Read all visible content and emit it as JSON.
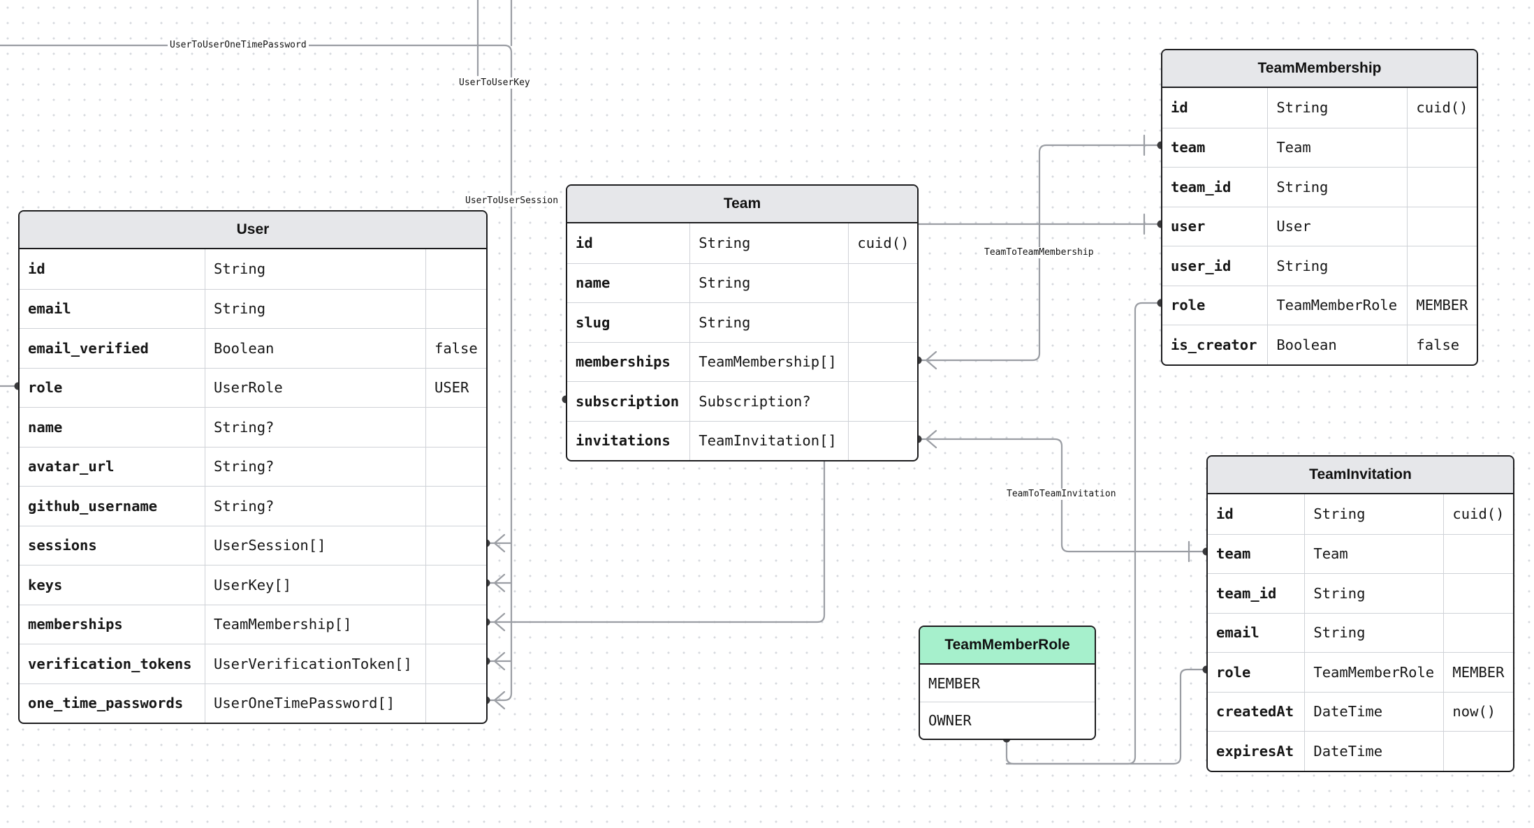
{
  "relations": {
    "user_to_user_one_time_password": "UserToUserOneTimePassword",
    "user_to_user_key": "UserToUserKey",
    "user_to_user_session": "UserToUserSession",
    "team_to_team_membership": "TeamToTeamMembership",
    "team_to_team_invitation": "TeamToTeamInvitation"
  },
  "models": {
    "user": {
      "name": "User",
      "fields": [
        {
          "name": "id",
          "type": "String",
          "default": ""
        },
        {
          "name": "email",
          "type": "String",
          "default": ""
        },
        {
          "name": "email_verified",
          "type": "Boolean",
          "default": "false"
        },
        {
          "name": "role",
          "type": "UserRole",
          "default": "USER"
        },
        {
          "name": "name",
          "type": "String?",
          "default": ""
        },
        {
          "name": "avatar_url",
          "type": "String?",
          "default": ""
        },
        {
          "name": "github_username",
          "type": "String?",
          "default": ""
        },
        {
          "name": "sessions",
          "type": "UserSession[]",
          "default": ""
        },
        {
          "name": "keys",
          "type": "UserKey[]",
          "default": ""
        },
        {
          "name": "memberships",
          "type": "TeamMembership[]",
          "default": ""
        },
        {
          "name": "verification_tokens",
          "type": "UserVerificationToken[]",
          "default": ""
        },
        {
          "name": "one_time_passwords",
          "type": "UserOneTimePassword[]",
          "default": ""
        }
      ]
    },
    "team": {
      "name": "Team",
      "fields": [
        {
          "name": "id",
          "type": "String",
          "default": "cuid()"
        },
        {
          "name": "name",
          "type": "String",
          "default": ""
        },
        {
          "name": "slug",
          "type": "String",
          "default": ""
        },
        {
          "name": "memberships",
          "type": "TeamMembership[]",
          "default": ""
        },
        {
          "name": "subscription",
          "type": "Subscription?",
          "default": ""
        },
        {
          "name": "invitations",
          "type": "TeamInvitation[]",
          "default": ""
        }
      ]
    },
    "team_membership": {
      "name": "TeamMembership",
      "fields": [
        {
          "name": "id",
          "type": "String",
          "default": "cuid()"
        },
        {
          "name": "team",
          "type": "Team",
          "default": ""
        },
        {
          "name": "team_id",
          "type": "String",
          "default": ""
        },
        {
          "name": "user",
          "type": "User",
          "default": ""
        },
        {
          "name": "user_id",
          "type": "String",
          "default": ""
        },
        {
          "name": "role",
          "type": "TeamMemberRole",
          "default": "MEMBER"
        },
        {
          "name": "is_creator",
          "type": "Boolean",
          "default": "false"
        }
      ]
    },
    "team_invitation": {
      "name": "TeamInvitation",
      "fields": [
        {
          "name": "id",
          "type": "String",
          "default": "cuid()"
        },
        {
          "name": "team",
          "type": "Team",
          "default": ""
        },
        {
          "name": "team_id",
          "type": "String",
          "default": ""
        },
        {
          "name": "email",
          "type": "String",
          "default": ""
        },
        {
          "name": "role",
          "type": "TeamMemberRole",
          "default": "MEMBER"
        },
        {
          "name": "createdAt",
          "type": "DateTime",
          "default": "now()"
        },
        {
          "name": "expiresAt",
          "type": "DateTime",
          "default": ""
        }
      ]
    }
  },
  "enums": {
    "team_member_role": {
      "name": "TeamMemberRole",
      "values": [
        "MEMBER",
        "OWNER"
      ]
    }
  },
  "colors": {
    "model_header": "#e6e7ea",
    "enum_header": "#a6f0cc",
    "connector": "#9a9da3",
    "border": "#1c1c1e"
  }
}
